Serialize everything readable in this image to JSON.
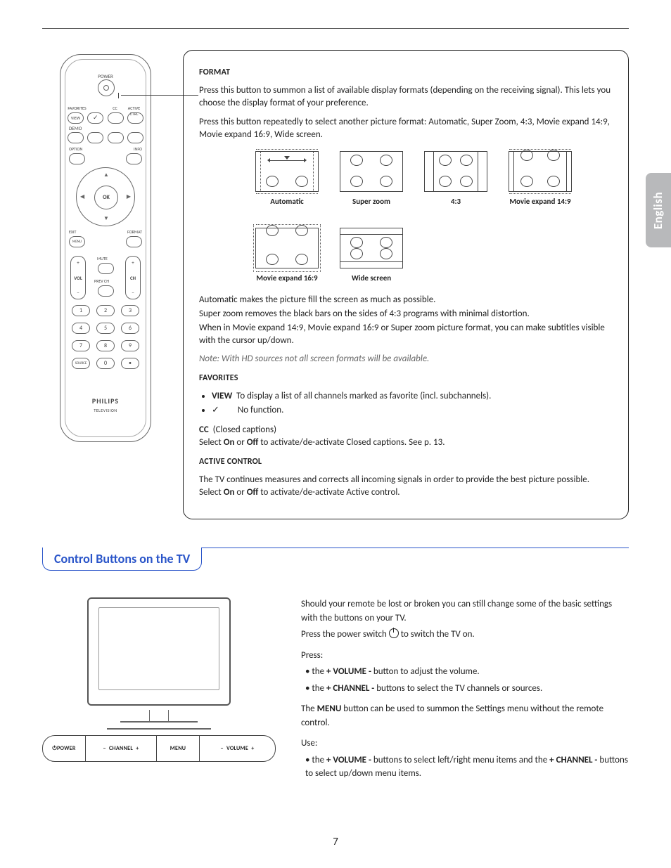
{
  "language_tab": "English",
  "page_number": "7",
  "remote": {
    "power": "POWER",
    "favorites": "FAVORITES",
    "cc": "CC",
    "active_ctrl": "ACTIVE CTRL",
    "view": "VIEW",
    "check": "✓",
    "demo": "DEMO",
    "option": "OPTION",
    "info": "INFO",
    "ok": "OK",
    "exit": "EXIT",
    "format": "FORMAT",
    "menu": "MENU",
    "mute": "MUTE",
    "vol": "VOL",
    "prev_ch": "PREV CH",
    "ch": "CH",
    "source": "SOURCE",
    "brand": "PHILIPS",
    "subbrand": "TELEVISION",
    "keys": [
      "1",
      "2",
      "3",
      "4",
      "5",
      "6",
      "7",
      "8",
      "9",
      "0",
      "•"
    ]
  },
  "format_section": {
    "heading": "FORMAT",
    "p1": "Press this button to summon a list of available display formats (depending on the receiving signal). This lets you choose the display format of your preference.",
    "p2": "Press this button repeatedly to select another picture format: Automatic, Super Zoom, 4:3, Movie expand 14:9, Movie expand 16:9, Wide screen.",
    "labels": {
      "automatic": "Automatic",
      "super_zoom": "Super zoom",
      "four_three": "4:3",
      "me149": "Movie expand 14:9",
      "me169": "Movie expand 16:9",
      "wide": "Wide screen"
    },
    "desc1": "Automatic makes the picture fill the screen as much as possible.",
    "desc2": "Super zoom removes the black bars on the sides of 4:3 programs with minimal distortion.",
    "desc3": "When in Movie expand 14:9, Movie expand 16:9 or Super zoom picture format, you can make subtitles visible with the cursor up/down.",
    "note": "Note: With HD sources not all screen formats will be available.",
    "favorites_heading": "FAVORITES",
    "fav_view_label": "VIEW",
    "fav_view_text": "To display a list of all channels marked as favorite (incl. subchannels).",
    "fav_check": "✓",
    "fav_check_text": "No function.",
    "cc_label": "CC",
    "cc_text1": "(Closed captions)",
    "cc_text2_a": "Select ",
    "cc_on": "On",
    "cc_or": " or ",
    "cc_off": "Off",
    "cc_text2_b": " to activate/de-activate Closed captions. See p. 13.",
    "active_heading": "ACTIVE CONTROL",
    "active_text_a": "The TV continues measures and corrects all incoming signals in order to provide the best picture possible. Select ",
    "active_text_b": " to activate/de-activate Active control."
  },
  "tv_section": {
    "title": "Control Buttons on the TV",
    "controls": {
      "power": "POWER",
      "channel": "CHANNEL",
      "menu": "MENU",
      "volume": "VOLUME"
    },
    "p1": "Should your remote be lost or broken you can still change some of the basic settings with the buttons on your TV.",
    "p2a": "Press the power switch ",
    "p2b": " to switch the TV on.",
    "press_label": "Press:",
    "b1_a": "the ",
    "b1_vol": "+ VOLUME -",
    "b1_b": " button to adjust the volume.",
    "b2_a": "the ",
    "b2_ch": "+ CHANNEL -",
    "b2_b": " buttons to select the TV channels or sources.",
    "menu_a": "The ",
    "menu_bold": "MENU",
    "menu_b": " button can be used to summon the Settings menu without the remote control.",
    "use_label": "Use:",
    "u1_a": "the ",
    "u1_vol": "+ VOLUME -",
    "u1_b": "  buttons to select left/right menu items and the ",
    "u1_ch": "+ CHANNEL -",
    "u1_c": " buttons to select up/down menu items."
  }
}
